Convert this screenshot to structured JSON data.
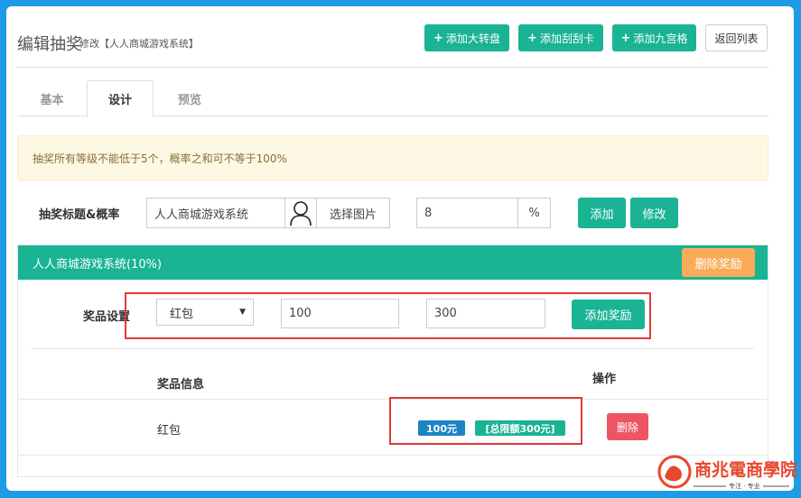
{
  "header": {
    "title": "编辑抽奖",
    "subtitle": "修改【人人商城游戏系统】",
    "buttons": {
      "add_wheel": "添加大转盘",
      "add_scratch": "添加刮刮卡",
      "add_grid": "添加九宫格",
      "back": "返回列表"
    }
  },
  "tabs": [
    "基本",
    "设计",
    "预览"
  ],
  "alert": "抽奖所有等级不能低于5个，概率之和可不等于100%",
  "form": {
    "label": "抽奖标题&概率",
    "title_value": "人人商城游戏系统",
    "select_image": "选择图片",
    "probability": "8",
    "percent": "%",
    "add": "添加",
    "modify": "修改"
  },
  "panel": {
    "title": "人人商城游戏系统(10%)",
    "delete_reward": "删除奖励",
    "prize_setting_label": "奖品设置",
    "prize_type": "红包",
    "min_value": "100",
    "max_value": "300",
    "add_reward": "添加奖励",
    "table": {
      "col_info": "奖品信息",
      "col_action": "操作",
      "rows": [
        {
          "name": "红包",
          "amount_badge": "100元",
          "limit_badge": "[总限额300元]",
          "delete": "删除"
        }
      ]
    }
  },
  "watermark": {
    "brand": "商兆電商學院",
    "tagline": "专注 · 专业"
  },
  "colors": {
    "primary": "#1ab394",
    "warning": "#f8ac59",
    "danger": "#ed5565",
    "info": "#1c84c6",
    "highlight": "#e03a3a"
  }
}
